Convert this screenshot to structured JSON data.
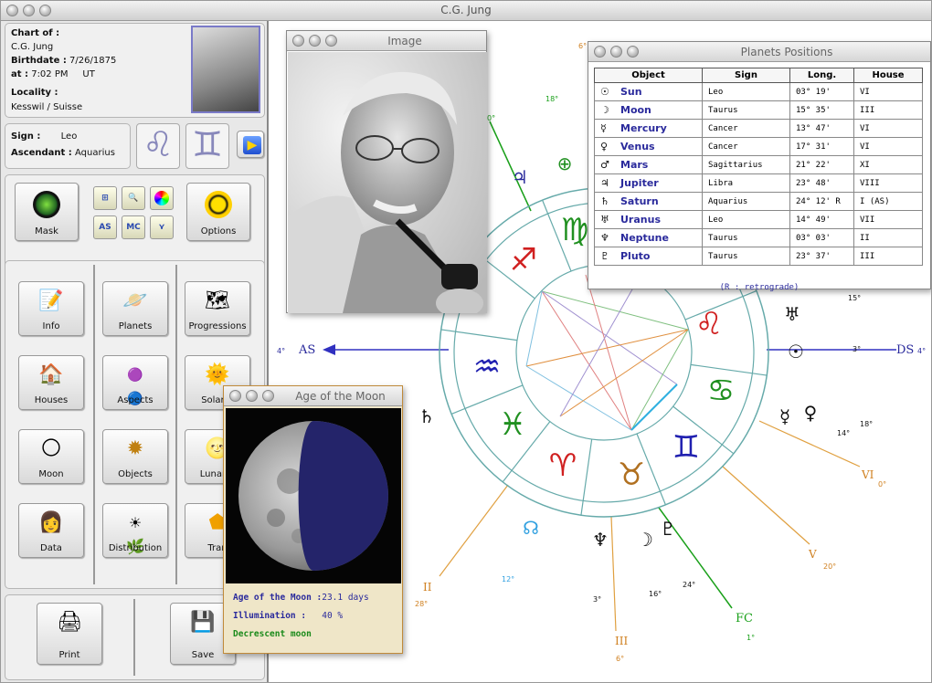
{
  "app": {
    "title": "C.G. Jung"
  },
  "chart_info": {
    "chart_of_label": "Chart of :",
    "name": "C.G. Jung",
    "birthdate_label": "Birthdate :",
    "birthdate": "7/26/1875",
    "at_label": "at :",
    "time": "7:02 PM",
    "tz": "UT",
    "locality_label": "Locality :",
    "locality": "Kesswil / Suisse",
    "sign_label": "Sign :",
    "sign": "Leo",
    "asc_label": "Ascendant :",
    "ascendant": "Aquarius"
  },
  "tools": {
    "mask": "Mask",
    "options": "Options",
    "small": [
      "AS",
      "MC"
    ]
  },
  "nav": {
    "col1": [
      "Info",
      "Houses",
      "Moon",
      "Data"
    ],
    "col2": [
      "Planets",
      "Aspects",
      "Objects",
      "Distribution"
    ],
    "col3": [
      "Progressions",
      "Solar R",
      "Lunar R",
      "Tran"
    ]
  },
  "bottom": {
    "print": "Print",
    "save": "Save"
  },
  "image_window": {
    "title": "Image"
  },
  "planets_window": {
    "title": "Planets Positions",
    "headers": [
      "Object",
      "Sign",
      "Long.",
      "House"
    ],
    "rows": [
      {
        "glyph": "☉",
        "object": "Sun",
        "sign": "Leo",
        "long": "03° 19'",
        "house": "VI"
      },
      {
        "glyph": "☽",
        "object": "Moon",
        "sign": "Taurus",
        "long": "15° 35'",
        "house": "III"
      },
      {
        "glyph": "☿",
        "object": "Mercury",
        "sign": "Cancer",
        "long": "13° 47'",
        "house": "VI"
      },
      {
        "glyph": "♀",
        "object": "Venus",
        "sign": "Cancer",
        "long": "17° 31'",
        "house": "VI"
      },
      {
        "glyph": "♂",
        "object": "Mars",
        "sign": "Sagittarius",
        "long": "21° 22'",
        "house": "XI"
      },
      {
        "glyph": "♃",
        "object": "Jupiter",
        "sign": "Libra",
        "long": "23° 48'",
        "house": "VIII"
      },
      {
        "glyph": "♄",
        "object": "Saturn",
        "sign": "Aquarius",
        "long": "24° 12' R",
        "house": "I (AS)"
      },
      {
        "glyph": "♅",
        "object": "Uranus",
        "sign": "Leo",
        "long": "14° 49'",
        "house": "VII"
      },
      {
        "glyph": "♆",
        "object": "Neptune",
        "sign": "Taurus",
        "long": "03° 03'",
        "house": "II"
      },
      {
        "glyph": "♇",
        "object": "Pluto",
        "sign": "Taurus",
        "long": "23° 37'",
        "house": "III"
      }
    ],
    "footnote": "(R : retrograde)"
  },
  "moon_window": {
    "title": "Age of the Moon",
    "age_label": "Age of the Moon :",
    "age_value": "23.1 days",
    "illum_label": "Illumination :",
    "illum_value": "40 %",
    "phase": "Decrescent moon",
    "illumination_fraction": 0.4
  },
  "wheel": {
    "as": "AS",
    "as_deg": "4°",
    "ds": "DS",
    "ds_deg": "4°",
    "fc": "FC",
    "fc_deg": "1°",
    "mc_deg": "0°",
    "house_labels": [
      "II",
      "III",
      "V",
      "VI"
    ],
    "house_degs": [
      "28°",
      "6°",
      "20°",
      "0°"
    ],
    "degree_marks": [
      "15°",
      "3°",
      "18°",
      "14°",
      "3°",
      "16°",
      "24°",
      "18°",
      "12°",
      "6°"
    ]
  }
}
